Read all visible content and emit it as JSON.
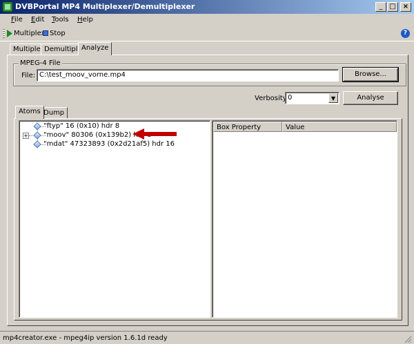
{
  "window": {
    "title": "DVBPortal MP4 Multiplexer/Demultiplexer"
  },
  "menu": [
    {
      "label": "File",
      "accel": "F",
      "rest": "ile"
    },
    {
      "label": "Edit",
      "accel": "E",
      "rest": "dit"
    },
    {
      "label": "Tools",
      "accel": "T",
      "rest": "ools"
    },
    {
      "label": "Help",
      "accel": "H",
      "rest": "elp"
    }
  ],
  "toolbar": {
    "multiplex_label": "Multiplex",
    "stop_label": "Stop"
  },
  "tabs": [
    "Multiplex",
    "Demultiplex",
    "Analyze"
  ],
  "active_tab": "Analyze",
  "mpeg_group": {
    "title": "MPEG-4 File",
    "file_label": "File:",
    "file_value": "C:\\test_moov_vorne.mp4",
    "browse_label": "Browse..."
  },
  "verbosity": {
    "label": "Verbosity",
    "value": "0"
  },
  "analyse_label": "Analyse",
  "subtabs": [
    "Atoms",
    "Dump"
  ],
  "tree": [
    {
      "text": "\"ftyp\" 16 (0x10) hdr 8",
      "expandable": false
    },
    {
      "text": "\"moov\" 80306 (0x139b2) hdr 8",
      "expandable": true
    },
    {
      "text": "\"mdat\" 47323893 (0x2d21af5) hdr 16",
      "expandable": false
    }
  ],
  "properties": {
    "headers": [
      "Box Property",
      "Value"
    ]
  },
  "annotation": {
    "color": "#c00000"
  },
  "status": {
    "text": "mp4creator.exe - mpeg4ip version 1.6.1d ready"
  }
}
